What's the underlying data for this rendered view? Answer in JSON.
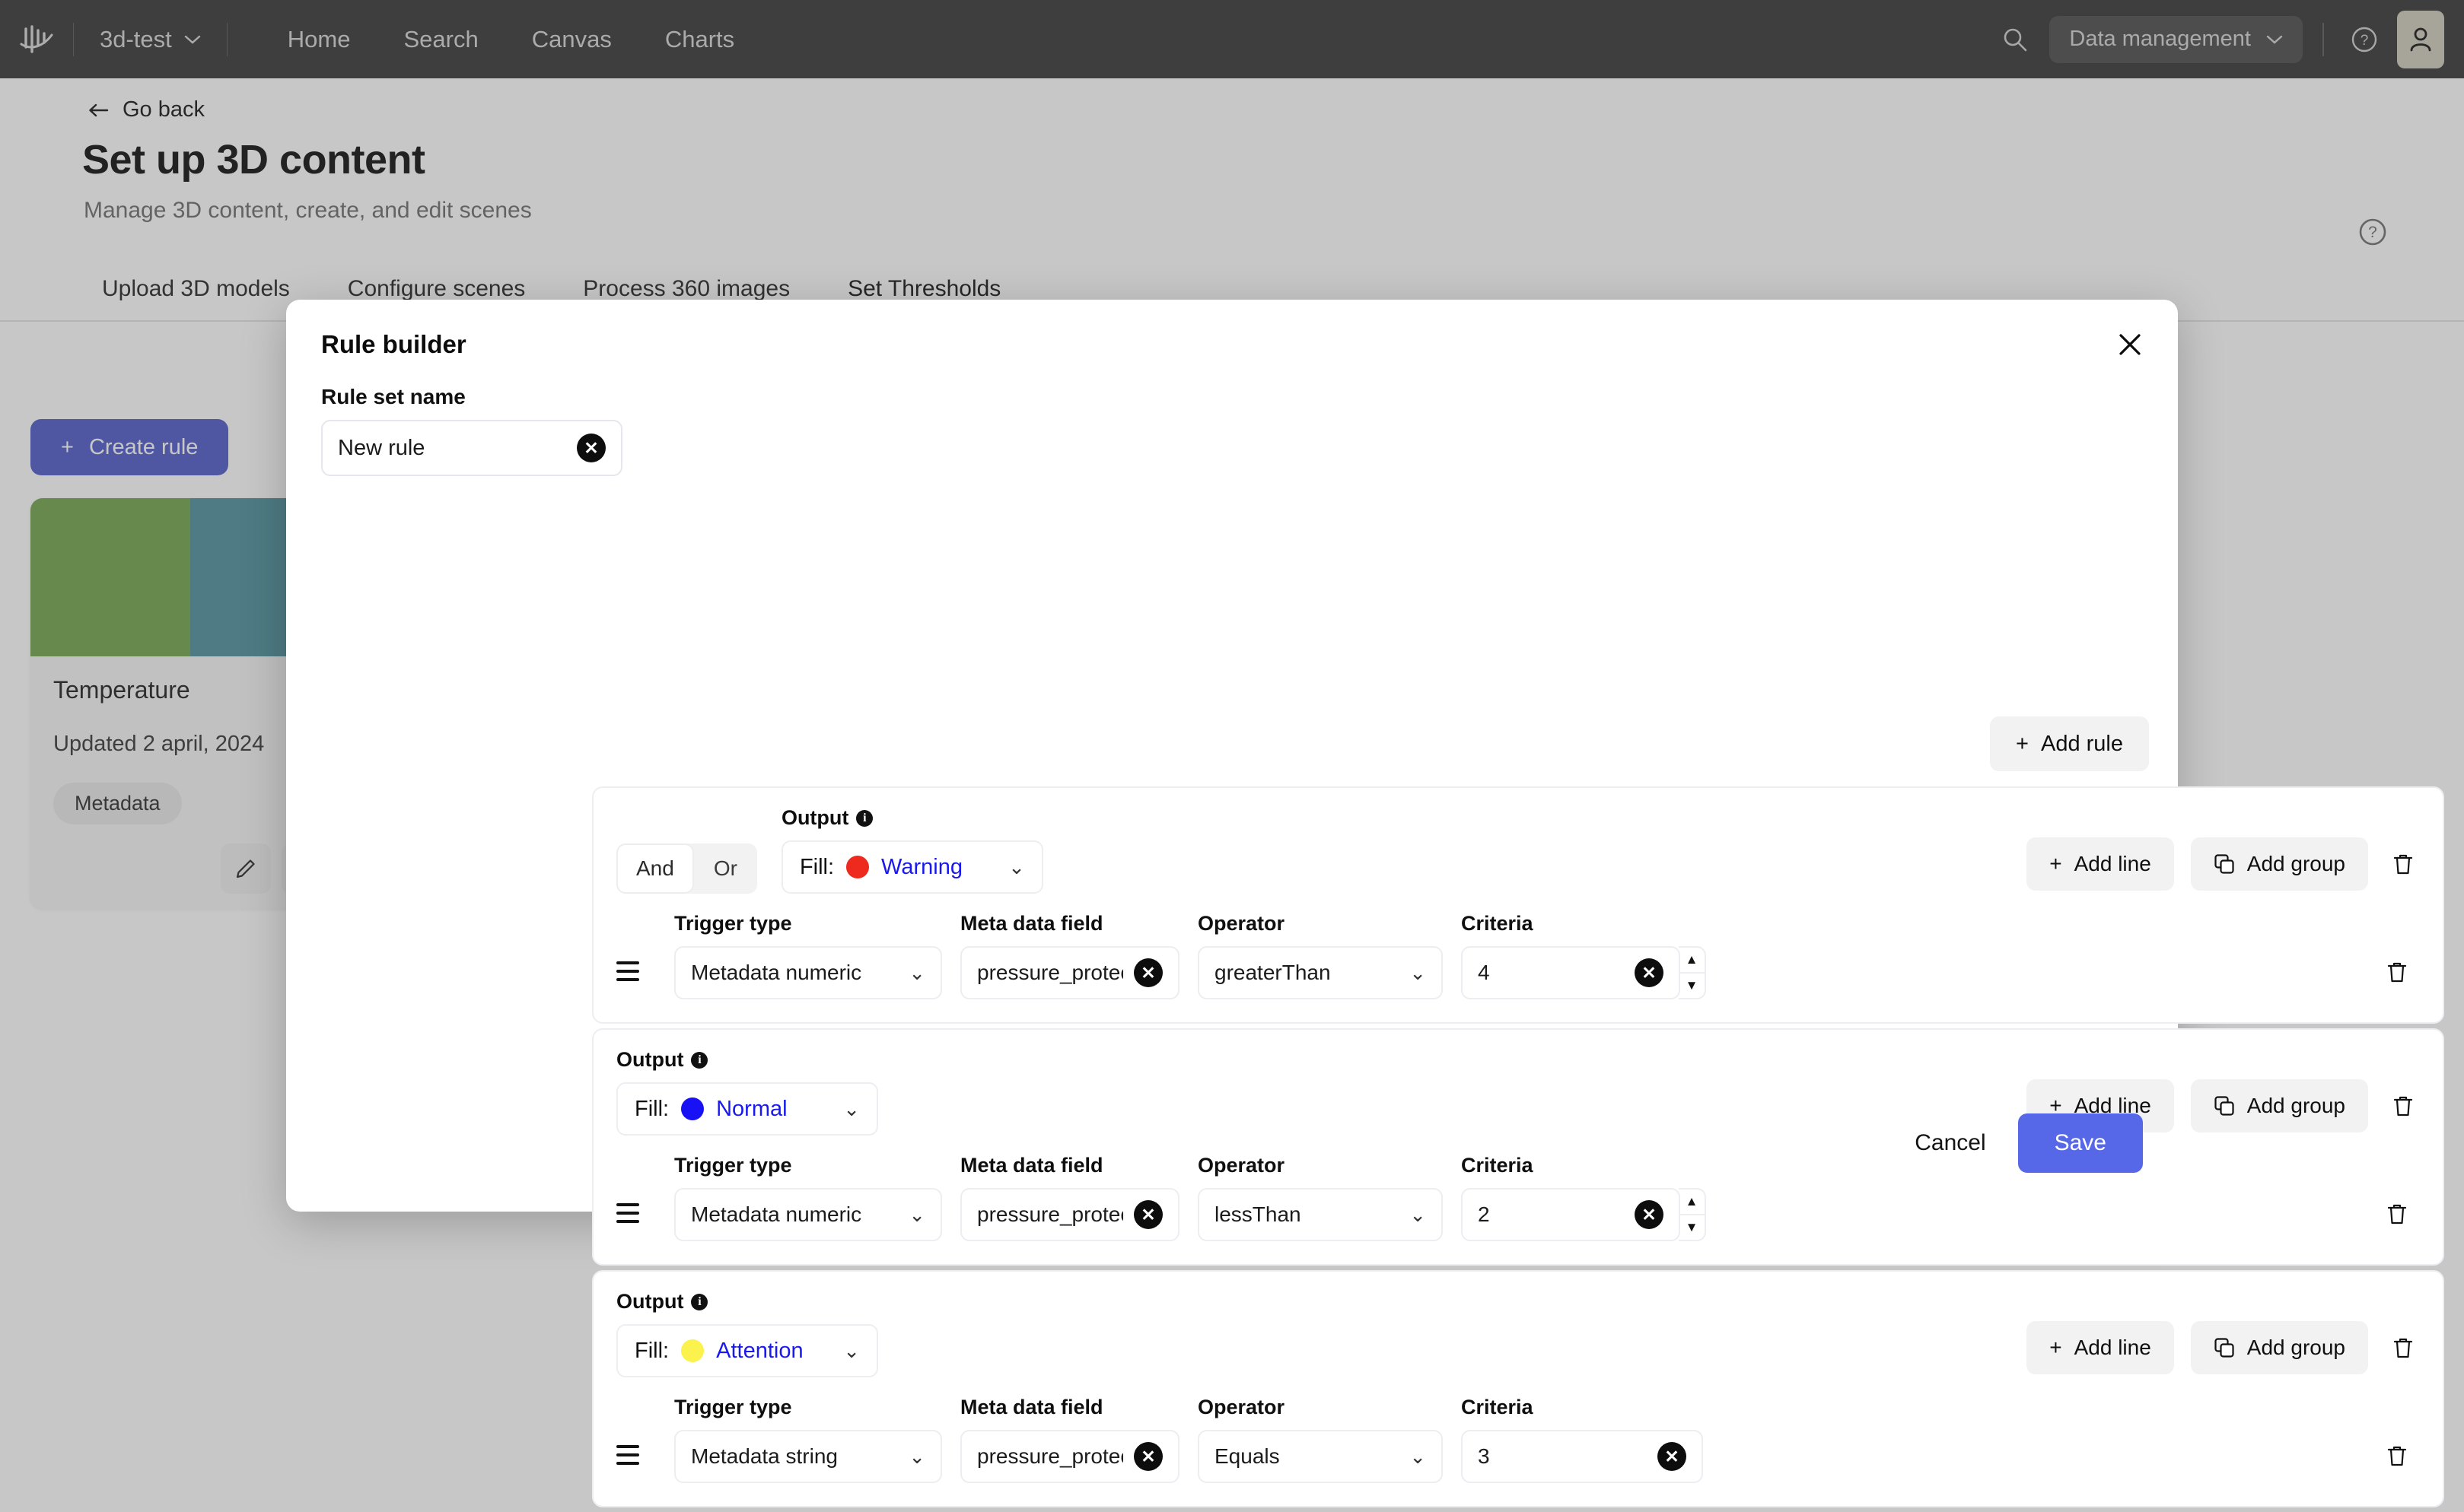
{
  "topnav": {
    "logo_icon": "cognite-logo-icon",
    "project": "3d-test",
    "links": [
      "Home",
      "Search",
      "Canvas",
      "Charts"
    ],
    "search_icon": "search-icon",
    "app_switcher": "Data management",
    "help_icon": "help-circle-icon",
    "avatar_icon": "user-avatar-icon"
  },
  "page": {
    "go_back": "Go back",
    "title": "Set up 3D content",
    "subtitle": "Manage 3D content, create, and edit scenes",
    "help_icon": "help-circle-icon",
    "tabs": [
      {
        "label": "Upload 3D models",
        "active": false
      },
      {
        "label": "Configure scenes",
        "active": false
      },
      {
        "label": "Process 360 images",
        "active": false
      },
      {
        "label": "Set Thresholds",
        "active": true
      }
    ],
    "create_rule": "Create rule",
    "card": {
      "swatch_colors": [
        "#72a34a",
        "#4b8e9b"
      ],
      "title": "Temperature",
      "updated": "Updated 2 april, 2024",
      "chip": "Metadata",
      "edit_icon": "pencil-icon",
      "delete_icon": "trash-icon"
    }
  },
  "modal": {
    "title": "Rule builder",
    "close_icon": "close-icon",
    "rule_set_name_label": "Rule set name",
    "rule_set_name_value": "New rule",
    "rule_set_name_placeholder": "Rule set name",
    "add_rule": "Add rule",
    "info_glyph": "i",
    "labels": {
      "output": "Output",
      "fill": "Fill:",
      "trigger_type": "Trigger type",
      "meta_data_field": "Meta data field",
      "operator": "Operator",
      "criteria": "Criteria",
      "add_line": "Add line",
      "add_group": "Add group"
    },
    "logic_toggle": {
      "and": "And",
      "or": "Or",
      "selected": "And"
    },
    "groups": [
      {
        "show_logic_toggle": true,
        "fill_label": "Warning",
        "fill_color": "#ee2a1e",
        "add_line": "Add line",
        "add_group": "Add group",
        "rows": [
          {
            "trigger_type": "Metadata numeric",
            "meta_data_field": "pressure_protec...",
            "operator": "greaterThan",
            "criteria": "4",
            "has_spinner": true
          }
        ]
      },
      {
        "show_logic_toggle": false,
        "fill_label": "Normal",
        "fill_color": "#1811f5",
        "add_line": "Add line",
        "add_group": "Add group",
        "rows": [
          {
            "trigger_type": "Metadata numeric",
            "meta_data_field": "pressure_protec...",
            "operator": "lessThan",
            "criteria": "2",
            "has_spinner": true
          }
        ]
      },
      {
        "show_logic_toggle": false,
        "fill_label": "Attention",
        "fill_color": "#fbf24e",
        "add_line": "Add line",
        "add_group": "Add group",
        "rows": [
          {
            "trigger_type": "Metadata string",
            "meta_data_field": "pressure_protec...",
            "operator": "Equals",
            "criteria": "3",
            "has_spinner": false
          }
        ]
      }
    ],
    "cancel": "Cancel",
    "save": "Save"
  }
}
